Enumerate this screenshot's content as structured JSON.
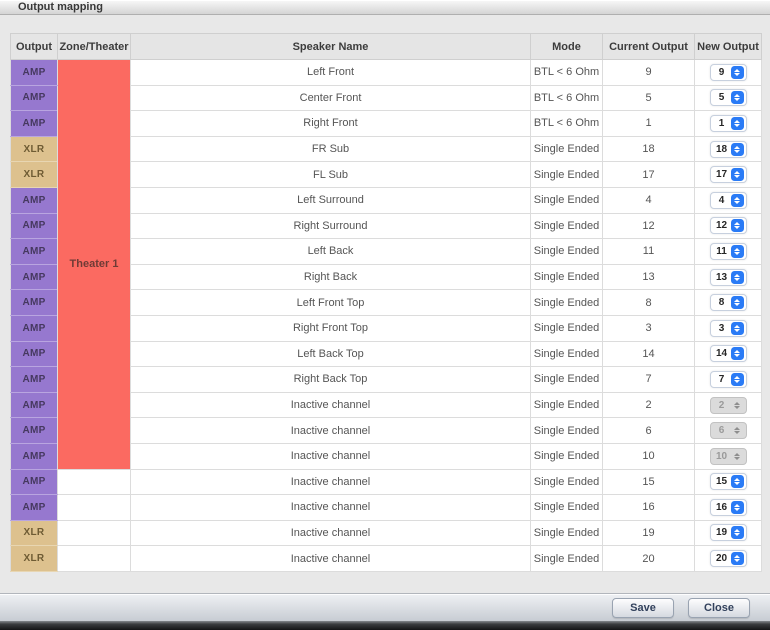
{
  "window": {
    "title": "Output mapping"
  },
  "colors": {
    "amp_badge": "#9678CF",
    "xlr_badge": "#DDC18E",
    "zone_active": "#FB6A61",
    "stepper_accent": "#2A7BF6",
    "stepper_disabled": "#DBDBDB"
  },
  "icons": {
    "stepper_arrows": "up-down-chevrons"
  },
  "table": {
    "columns": [
      {
        "key": "output",
        "label": "Output"
      },
      {
        "key": "zone",
        "label": "Zone/Theater"
      },
      {
        "key": "speaker",
        "label": "Speaker Name"
      },
      {
        "key": "mode",
        "label": "Mode"
      },
      {
        "key": "current",
        "label": "Current Output"
      },
      {
        "key": "new",
        "label": "New Output"
      }
    ],
    "zone": {
      "label": "Theater 1",
      "row_span": 16
    },
    "rows": [
      {
        "output": "AMP",
        "speaker": "Left Front",
        "mode": "BTL < 6 Ohm",
        "current": "9",
        "new": "9",
        "enabled": true
      },
      {
        "output": "AMP",
        "speaker": "Center Front",
        "mode": "BTL < 6 Ohm",
        "current": "5",
        "new": "5",
        "enabled": true
      },
      {
        "output": "AMP",
        "speaker": "Right Front",
        "mode": "BTL < 6 Ohm",
        "current": "1",
        "new": "1",
        "enabled": true
      },
      {
        "output": "XLR",
        "speaker": "FR Sub",
        "mode": "Single Ended",
        "current": "18",
        "new": "18",
        "enabled": true
      },
      {
        "output": "XLR",
        "speaker": "FL Sub",
        "mode": "Single Ended",
        "current": "17",
        "new": "17",
        "enabled": true
      },
      {
        "output": "AMP",
        "speaker": "Left Surround",
        "mode": "Single Ended",
        "current": "4",
        "new": "4",
        "enabled": true
      },
      {
        "output": "AMP",
        "speaker": "Right Surround",
        "mode": "Single Ended",
        "current": "12",
        "new": "12",
        "enabled": true
      },
      {
        "output": "AMP",
        "speaker": "Left Back",
        "mode": "Single Ended",
        "current": "11",
        "new": "11",
        "enabled": true
      },
      {
        "output": "AMP",
        "speaker": "Right Back",
        "mode": "Single Ended",
        "current": "13",
        "new": "13",
        "enabled": true
      },
      {
        "output": "AMP",
        "speaker": "Left Front Top",
        "mode": "Single Ended",
        "current": "8",
        "new": "8",
        "enabled": true
      },
      {
        "output": "AMP",
        "speaker": "Right Front Top",
        "mode": "Single Ended",
        "current": "3",
        "new": "3",
        "enabled": true
      },
      {
        "output": "AMP",
        "speaker": "Left Back Top",
        "mode": "Single Ended",
        "current": "14",
        "new": "14",
        "enabled": true
      },
      {
        "output": "AMP",
        "speaker": "Right Back Top",
        "mode": "Single Ended",
        "current": "7",
        "new": "7",
        "enabled": true
      },
      {
        "output": "AMP",
        "speaker": "Inactive channel",
        "mode": "Single Ended",
        "current": "2",
        "new": "2",
        "enabled": false
      },
      {
        "output": "AMP",
        "speaker": "Inactive channel",
        "mode": "Single Ended",
        "current": "6",
        "new": "6",
        "enabled": false
      },
      {
        "output": "AMP",
        "speaker": "Inactive channel",
        "mode": "Single Ended",
        "current": "10",
        "new": "10",
        "enabled": false
      },
      {
        "output": "AMP",
        "speaker": "Inactive channel",
        "mode": "Single Ended",
        "current": "15",
        "new": "15",
        "enabled": true
      },
      {
        "output": "AMP",
        "speaker": "Inactive channel",
        "mode": "Single Ended",
        "current": "16",
        "new": "16",
        "enabled": true
      },
      {
        "output": "XLR",
        "speaker": "Inactive channel",
        "mode": "Single Ended",
        "current": "19",
        "new": "19",
        "enabled": true
      },
      {
        "output": "XLR",
        "speaker": "Inactive channel",
        "mode": "Single Ended",
        "current": "20",
        "new": "20",
        "enabled": true
      }
    ]
  },
  "footer": {
    "save_label": "Save",
    "close_label": "Close"
  }
}
